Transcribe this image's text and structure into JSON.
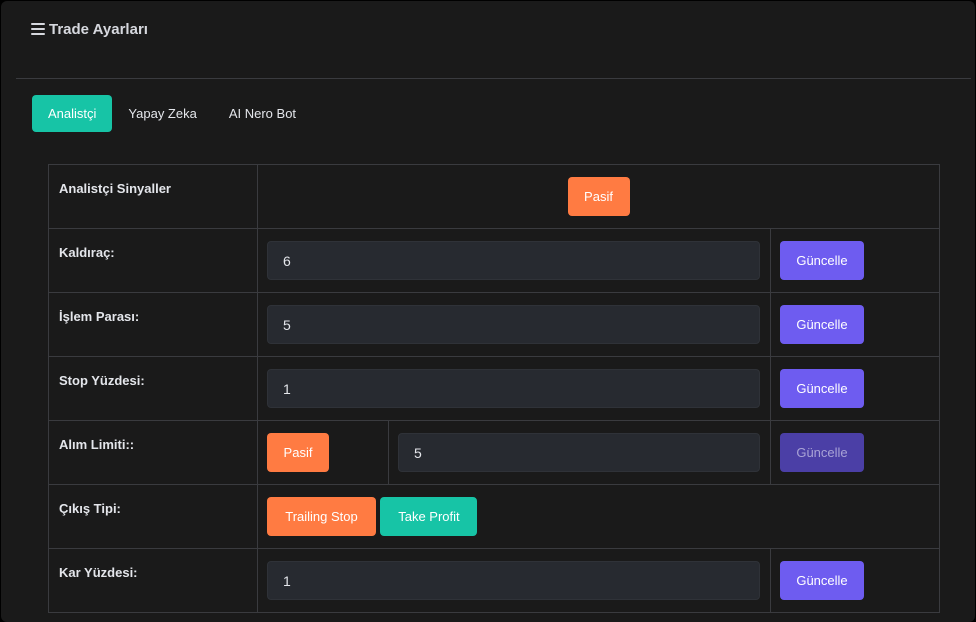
{
  "header": {
    "title": "Trade Ayarları",
    "icon": "menu-icon"
  },
  "tabs": [
    {
      "label": "Analistçi",
      "active": true
    },
    {
      "label": "Yapay Zeka",
      "active": false
    },
    {
      "label": "AI Nero Bot",
      "active": false
    }
  ],
  "rows": {
    "signals": {
      "label": "Analistçi Sinyaller",
      "status_button": "Pasif"
    },
    "leverage": {
      "label": "Kaldıraç:",
      "value": "6",
      "button": "Güncelle"
    },
    "trade_amount": {
      "label": "İşlem Parası:",
      "value": "5",
      "button": "Güncelle"
    },
    "stop_percent": {
      "label": "Stop Yüzdesi:",
      "value": "1",
      "button": "Güncelle"
    },
    "buy_limit": {
      "label": "Alım Limiti::",
      "status_button": "Pasif",
      "value": "5",
      "button": "Güncelle"
    },
    "exit_type": {
      "label": "Çıkış Tipi:",
      "trailing_button": "Trailing Stop",
      "take_profit_button": "Take Profit"
    },
    "profit_percent": {
      "label": "Kar Yüzdesi:",
      "value": "1",
      "button": "Güncelle"
    }
  },
  "colors": {
    "accent_teal": "#17c4a6",
    "accent_orange": "#ff7b42",
    "accent_purple": "#6e5cf0",
    "background": "#1a1a1a"
  }
}
